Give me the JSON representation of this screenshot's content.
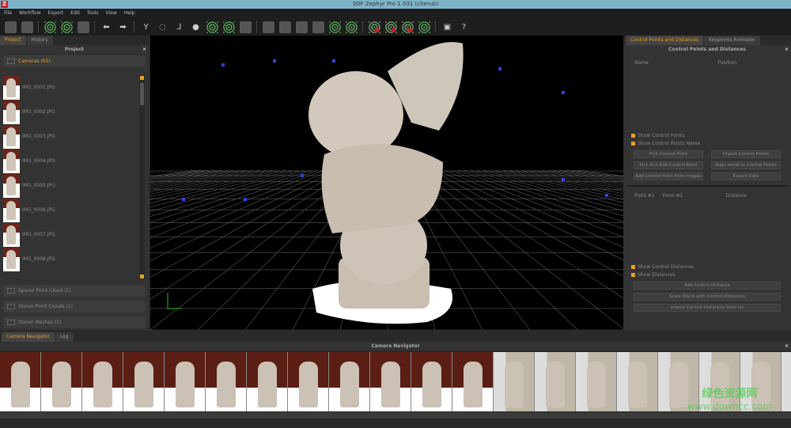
{
  "window": {
    "title": "3DF Zephyr Pro 1.031 (cherub)",
    "logo": "Z"
  },
  "menu": [
    "File",
    "Workflow",
    "Export",
    "Edit",
    "Tools",
    "View",
    "Help"
  ],
  "toolbar_icons": [
    "new-project-icon",
    "save-icon",
    "sparse-cloud-icon",
    "dense-cloud-icon",
    "mesh-icon",
    "undo-icon",
    "redo-icon",
    "tools-icon",
    "orbit-icon",
    "axis-icon",
    "light-icon",
    "points-icon",
    "colored-points-icon",
    "solid-icon",
    "select-icon",
    "select-add-icon",
    "select-remove-icon",
    "select-lasso-icon",
    "pick-points-icon",
    "pick-points-all-icon",
    "delete-points-icon",
    "delete-colored-icon",
    "delete-mesh-icon",
    "filter-icon",
    "camera-icon",
    "help-icon"
  ],
  "left": {
    "tabs": [
      "Project",
      "History"
    ],
    "title": "Project",
    "cameras": "Cameras (65)",
    "images": [
      "IMG_0001.JPG",
      "IMG_0002.JPG",
      "IMG_0003.JPG",
      "IMG_0004.JPG",
      "IMG_0005.JPG",
      "IMG_0006.JPG",
      "IMG_0007.JPG",
      "IMG_0008.JPG"
    ],
    "groups": [
      "Sparse Point Cloud (1)",
      "Stereo Point Clouds (1)",
      "Stereo Meshes (1)"
    ]
  },
  "right": {
    "tabs": [
      "Control Points and Distances",
      "Keypoints Animator"
    ],
    "title": "Control Points and Distances",
    "cols1": [
      "Name",
      "Position"
    ],
    "chk1": [
      "Show Control Points",
      "Show Control Points Name"
    ],
    "buttons": [
      [
        "Pick Control Point",
        "Import Control Points"
      ],
      [
        "Pick And Edit Control Point",
        "Align world to Control Points"
      ],
      [
        "Add Control Point from images",
        "Export Data"
      ]
    ],
    "cols2": [
      "Point #1",
      "Point #2",
      "Distance"
    ],
    "chk2": [
      "Show Control Distances",
      "Show Distances"
    ],
    "buttons2": [
      "Add Control Distance",
      "Scale World with Control Distances",
      "Import Control Distances from txt"
    ]
  },
  "bottom": {
    "tabs": [
      "Camera Navigator",
      "Log"
    ],
    "title": "Camera Navigator"
  },
  "watermark": {
    "cn": "绿色资源网",
    "url": "www.downcc.com"
  },
  "colors": {
    "accent": "#e8a020",
    "titlebar": "#7fb4c8"
  }
}
